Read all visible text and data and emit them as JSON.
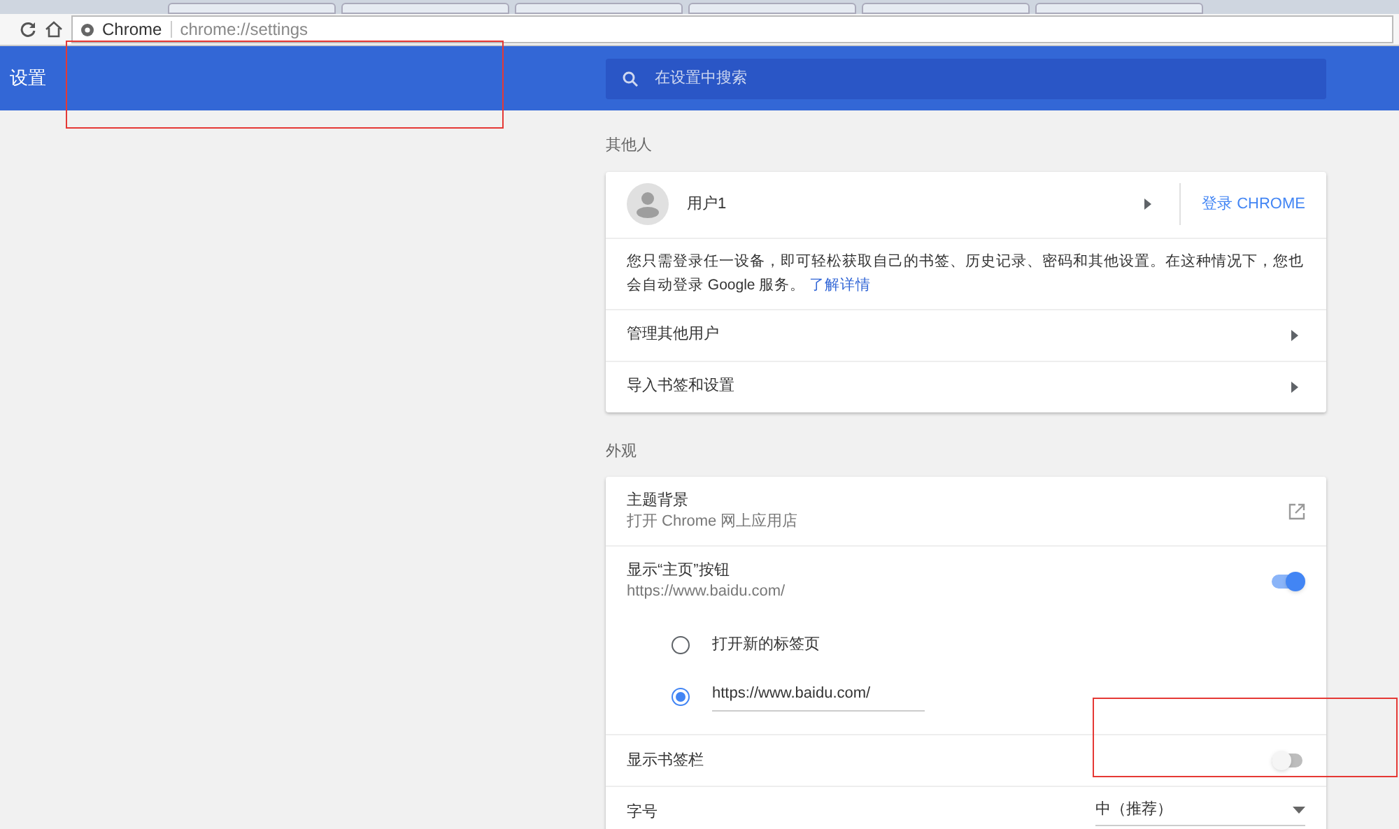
{
  "address_bar": {
    "site": "Chrome",
    "url": "chrome://settings"
  },
  "header": {
    "title": "设置",
    "search": {
      "placeholder": "在设置中搜索"
    }
  },
  "people": {
    "heading": "其他人",
    "profile_name": "用户1",
    "sign_in": "登录 CHROME",
    "description": "您只需登录任一设备，即可轻松获取自己的书签、历史记录、密码和其他设置。在这种情况下，您也会自动登录 Google 服务。",
    "learn_more": "了解详情",
    "rows": [
      {
        "label": "管理其他用户"
      },
      {
        "label": "导入书签和设置"
      }
    ]
  },
  "appearance": {
    "heading": "外观",
    "theme": {
      "label": "主题背景",
      "sublabel": "打开 Chrome 网上应用店"
    },
    "home_button": {
      "label": "显示“主页”按钮",
      "sublabel": "https://www.baidu.com/",
      "on": true,
      "options": [
        {
          "label": "打开新的标签页",
          "selected": false,
          "kind": "text"
        },
        {
          "label": "https://www.baidu.com/",
          "selected": true,
          "kind": "field"
        }
      ]
    },
    "bookmarks_bar": {
      "label": "显示书签栏",
      "on": false
    },
    "font_size": {
      "label": "字号",
      "value": "中（推荐）"
    }
  }
}
